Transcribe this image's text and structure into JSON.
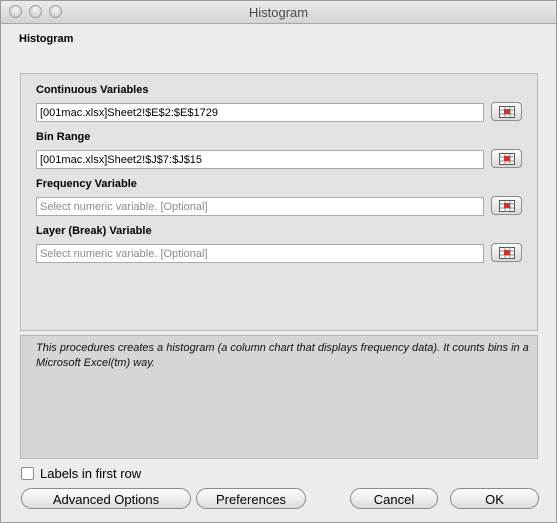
{
  "window": {
    "title": "Histogram"
  },
  "section_title": "Histogram",
  "fields": [
    {
      "label": "Continuous Variables",
      "value": "[001mac.xlsx]Sheet2!$E$2:$E$1729",
      "placeholder": ""
    },
    {
      "label": "Bin Range",
      "value": "[001mac.xlsx]Sheet2!$J$7:$J$15",
      "placeholder": ""
    },
    {
      "label": "Frequency Variable",
      "value": "",
      "placeholder": "Select numeric variable. [Optional]"
    },
    {
      "label": "Layer (Break) Variable",
      "value": "",
      "placeholder": "Select numeric variable. [Optional]"
    }
  ],
  "description": "This procedures creates a histogram (a column chart that displays frequency data). It counts bins in a Microsoft Excel(tm) way.",
  "options": {
    "labels_first_row": "Labels in first row",
    "labels_first_row_checked": false
  },
  "buttons": {
    "advanced": "Advanced Options",
    "preferences": "Preferences",
    "cancel": "Cancel",
    "ok": "OK"
  },
  "icons": {
    "range_selector": "range-selector-icon"
  }
}
